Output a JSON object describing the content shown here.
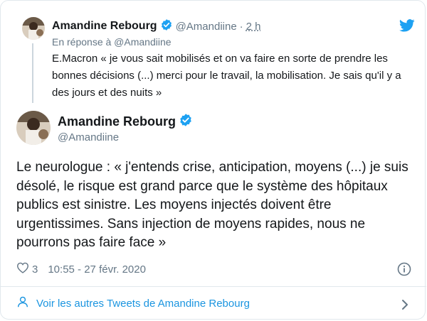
{
  "parent_tweet": {
    "author_name": "Amandine Rebourg",
    "handle": "@Amandiine",
    "separator": "·",
    "time_ago": "2 h",
    "reply_to_label": "En réponse à @Amandiine",
    "text": "E.Macron « je vous sait mobilisés et on va faire en sorte de prendre les bonnes décisions (...) merci pour le travail, la mobilisation. Je sais qu'il y a des jours et des nuits »"
  },
  "main_tweet": {
    "author_name": "Amandine Rebourg",
    "handle": "@Amandiine",
    "text": "Le neurologue : « j'entends crise, anticipation, moyens (...) je suis désolé, le risque est grand parce que le système des hôpitaux publics est sinistre. Les moyens injectés doivent être urgentissimes. Sans injection de moyens rapides, nous ne pourrons pas faire face »",
    "likes": "3",
    "datetime": "10:55 - 27 févr. 2020"
  },
  "footer": {
    "more_tweets_label": "Voir les autres Tweets de Amandine Rebourg"
  },
  "colors": {
    "twitter_blue": "#1da1f2",
    "link_blue": "#1b95e0",
    "muted_gray": "#657786",
    "text": "#14171a"
  },
  "icons": [
    "twitter-bird-icon",
    "verified-badge-icon",
    "heart-icon",
    "info-icon",
    "person-icon",
    "chevron-right-icon"
  ]
}
